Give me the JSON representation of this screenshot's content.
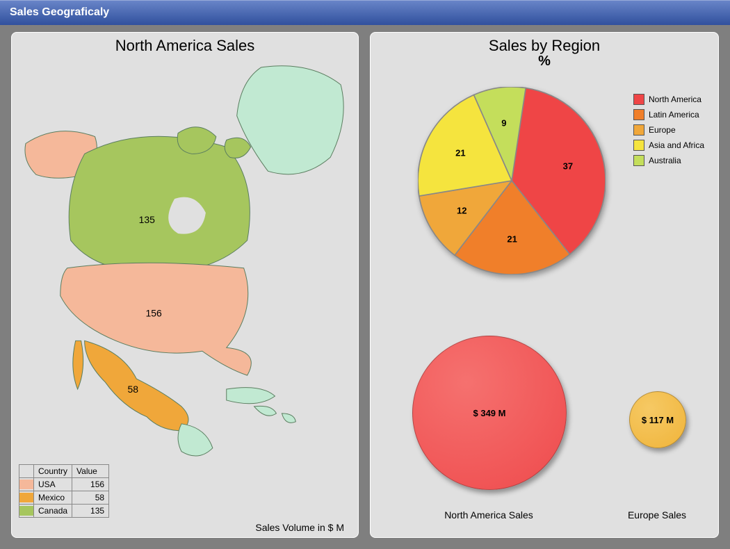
{
  "header": {
    "title": "Sales Geograficaly"
  },
  "map_chart": {
    "title": "North America Sales",
    "caption": "Sales Volume in $ M",
    "table_headers": {
      "country": "Country",
      "value": "Value"
    },
    "rows": [
      {
        "country": "USA",
        "value": "156",
        "color": "#f5b89a"
      },
      {
        "country": "Mexico",
        "value": "58",
        "color": "#f0a73a"
      },
      {
        "country": "Canada",
        "value": "135",
        "color": "#a6c65e"
      }
    ],
    "colors": {
      "other": "#c1e9d2",
      "stroke": "#7ca88c"
    },
    "marker_labels": {
      "canada": "135",
      "usa": "156",
      "mexico": "58"
    }
  },
  "pie_chart": {
    "title": "Sales by Region",
    "subtitle": "%",
    "legend": [
      {
        "name": "North America",
        "color": "#ef4546"
      },
      {
        "name": "Latin America",
        "color": "#f07f2a"
      },
      {
        "name": "Europe",
        "color": "#f0a73a"
      },
      {
        "name": "Asia and Africa",
        "color": "#f5e43e"
      },
      {
        "name": "Australia",
        "color": "#c4de5b"
      }
    ]
  },
  "bubbles": {
    "na": {
      "label": "$ 349 M",
      "caption": "North America Sales",
      "color": "#ef4a4c"
    },
    "eu": {
      "label": "$ 117 M",
      "caption": "Europe Sales",
      "color": "#f0b43a"
    }
  },
  "chart_data": [
    {
      "type": "pie",
      "title": "Sales by Region %",
      "categories": [
        "North America",
        "Latin America",
        "Europe",
        "Asia and Africa",
        "Australia"
      ],
      "values": [
        37,
        21,
        12,
        21,
        9
      ],
      "colors": [
        "#ef4546",
        "#f07f2a",
        "#f0a73a",
        "#f5e43e",
        "#c4de5b"
      ],
      "legend_position": "right"
    },
    {
      "type": "bubble",
      "title": "Regional Sales ($ M)",
      "series": [
        {
          "name": "North America Sales",
          "value": 349,
          "color": "#ef4a4c"
        },
        {
          "name": "Europe Sales",
          "value": 117,
          "color": "#f0b43a"
        }
      ]
    },
    {
      "type": "choropleth",
      "title": "North America Sales",
      "ylabel": "Sales Volume in $ M",
      "categories": [
        "USA",
        "Mexico",
        "Canada"
      ],
      "values": [
        156,
        58,
        135
      ],
      "colors": [
        "#f5b89a",
        "#f0a73a",
        "#a6c65e"
      ]
    }
  ]
}
